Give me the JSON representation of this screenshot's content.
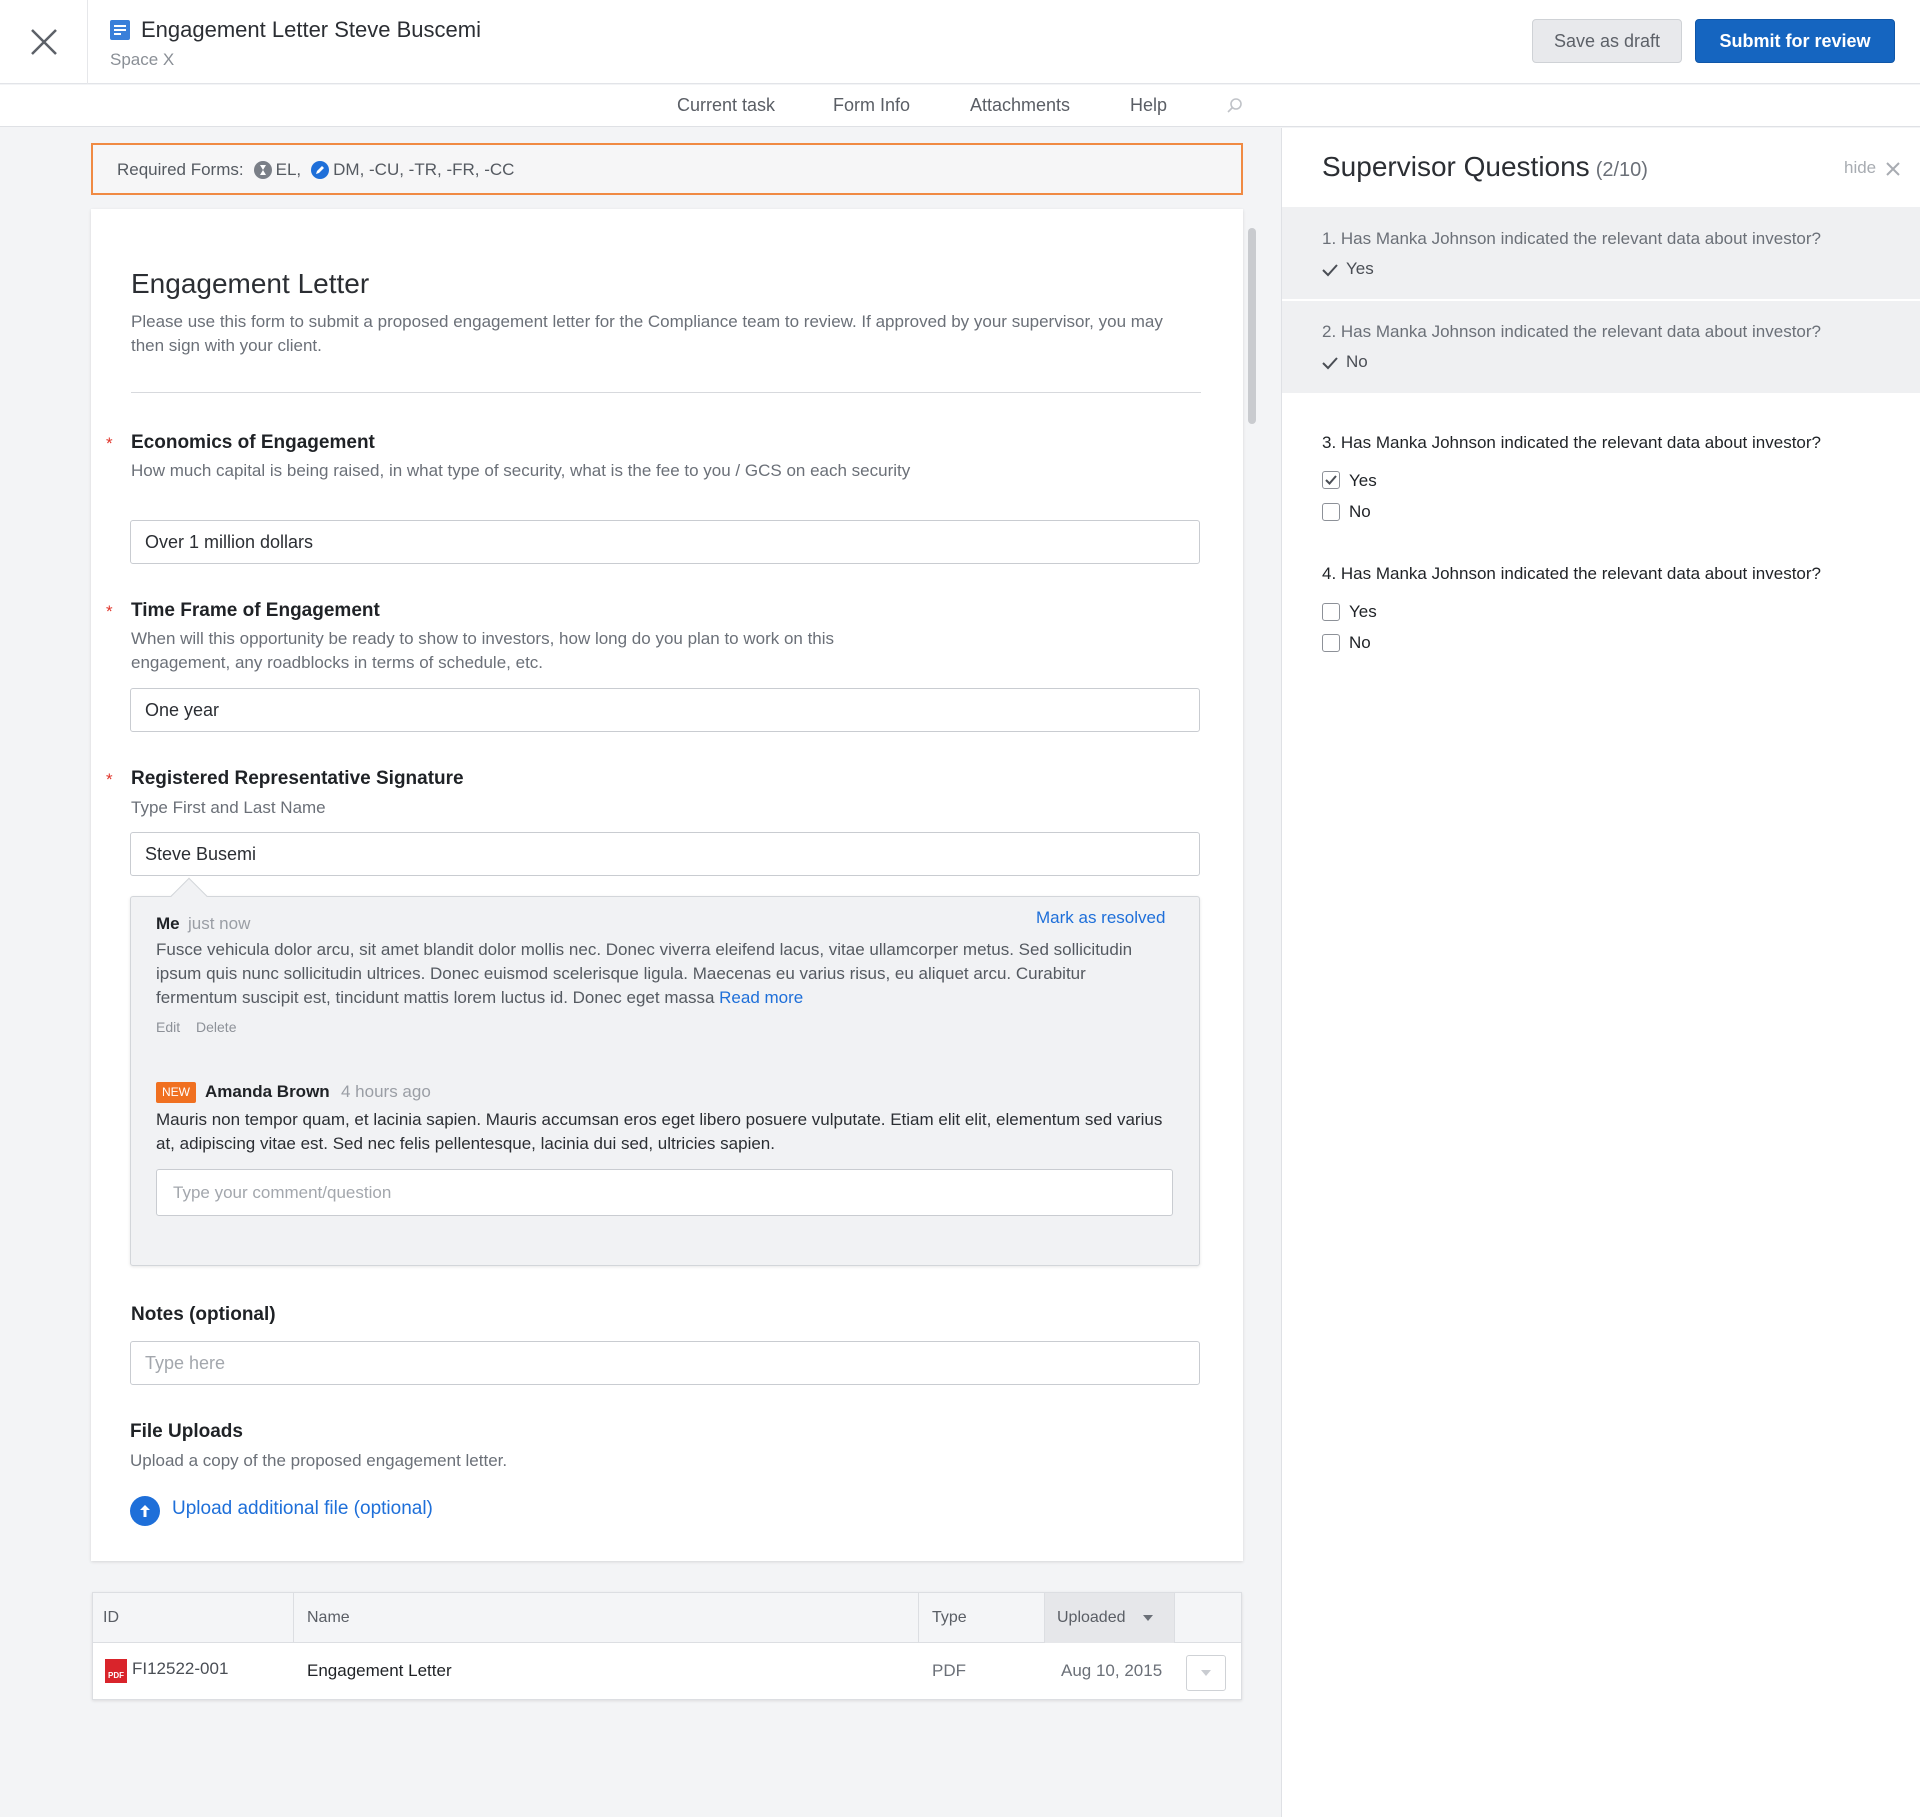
{
  "header": {
    "title": "Engagement Letter Steve Buscemi",
    "subtitle": "Space X",
    "save_draft_label": "Save as draft",
    "submit_label": "Submit for review"
  },
  "tabs": [
    {
      "label": "Current task"
    },
    {
      "label": "Form Info"
    },
    {
      "label": "Attachments"
    },
    {
      "label": "Help"
    }
  ],
  "required_forms": {
    "label": "Required Forms:",
    "item_el": "EL,",
    "item_dm": "DM, -CU, -TR, -FR, -CC"
  },
  "form": {
    "title": "Engagement Letter",
    "description": "Please use this form to submit a proposed engagement letter for the Compliance team to review. If approved by your supervisor, you may then sign with your client.",
    "fields": [
      {
        "label": "Economics of Engagement",
        "required": true,
        "help": "How much capital is being raised, in what type of security, what is the fee to you / GCS on each security",
        "value": "Over 1 million dollars"
      },
      {
        "label": "Time Frame of Engagement",
        "required": true,
        "help": "When will this opportunity be ready to show to investors, how long do you plan to work on this engagement, any roadblocks in terms of schedule, etc.",
        "value": "One year"
      },
      {
        "label": "Registered Representative Signature",
        "required": true,
        "help": "Type First and Last Name",
        "value": "Steve Busemi"
      }
    ],
    "notes": {
      "label": "Notes (optional)",
      "placeholder": "Type here"
    },
    "uploads": {
      "label": "File Uploads",
      "help": "Upload a copy of the proposed engagement letter.",
      "action": "Upload additional file (optional)"
    }
  },
  "comments": {
    "mark_resolved": "Mark as resolved",
    "items": [
      {
        "author": "Me",
        "time": "just now",
        "body": "Fusce vehicula dolor arcu, sit amet blandit dolor mollis nec. Donec viverra eleifend lacus, vitae ullamcorper metus. Sed sollicitudin ipsum quis nunc sollicitudin ultrices. Donec euismod scelerisque ligula. Maecenas eu varius risus, eu aliquet arcu. Curabitur fermentum suscipit est, tincidunt mattis lorem luctus id. Donec eget massa",
        "read_more": "Read more",
        "edit": "Edit",
        "delete": "Delete"
      },
      {
        "badge": "NEW",
        "author": "Amanda Brown",
        "time": "4 hours ago",
        "body": "Mauris non tempor quam, et lacinia sapien. Mauris accumsan eros eget libero posuere vulputate. Etiam elit elit, elementum sed varius at, adipiscing vitae est. Sed nec felis pellentesque, lacinia dui sed, ultricies sapien."
      }
    ],
    "input_placeholder": "Type your comment/question"
  },
  "table": {
    "columns": [
      "ID",
      "Name",
      "Type",
      "Uploaded"
    ],
    "rows": [
      {
        "id": "FI12522-001",
        "name": "Engagement Letter",
        "type": "PDF",
        "uploaded": "Aug 10, 2015",
        "icon": "pdf-icon"
      }
    ]
  },
  "side_panel": {
    "title": "Supervisor Questions",
    "count": "(2/10)",
    "hide_label": "hide",
    "questions": [
      {
        "text": "1. Has Manka Johnson indicated the relevant data about investor?",
        "answer": "Yes",
        "answered": true
      },
      {
        "text": "2. Has Manka Johnson indicated the relevant data about investor?",
        "answer": "No",
        "answered": true
      },
      {
        "text": "3. Has Manka Johnson indicated the relevant data about investor?",
        "options": [
          {
            "label": "Yes",
            "checked": true
          },
          {
            "label": "No",
            "checked": false
          }
        ]
      },
      {
        "text": "4. Has Manka Johnson indicated the relevant data about investor?",
        "options": [
          {
            "label": "Yes",
            "checked": false
          },
          {
            "label": "No",
            "checked": false
          }
        ]
      }
    ]
  },
  "colors": {
    "primary": "#1565c0",
    "link": "#1e6fd9",
    "warning_border": "#f08a43",
    "required": "#e0342a",
    "new_badge": "#f07020"
  }
}
